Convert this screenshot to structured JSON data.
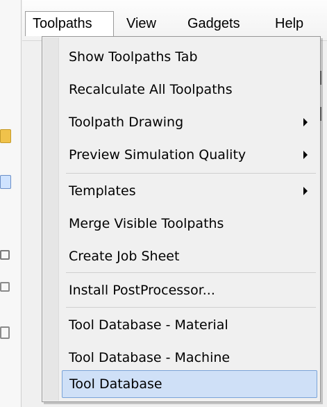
{
  "menubar": {
    "items": [
      {
        "label": "Toolpaths"
      },
      {
        "label": "View"
      },
      {
        "label": "Gadgets"
      },
      {
        "label": "Help"
      }
    ]
  },
  "dropdown": {
    "items": [
      {
        "label": "Show Toolpaths Tab"
      },
      {
        "label": "Recalculate All Toolpaths"
      },
      {
        "label": "Toolpath Drawing"
      },
      {
        "label": "Preview Simulation Quality"
      },
      {
        "label": "Templates"
      },
      {
        "label": "Merge Visible Toolpaths"
      },
      {
        "label": "Create Job Sheet"
      },
      {
        "label": "Install PostProcessor..."
      },
      {
        "label": "Tool Database - Material"
      },
      {
        "label": "Tool Database - Machine"
      },
      {
        "label": "Tool Database"
      }
    ]
  },
  "icons": {
    "submenu_indicator": "chevron-right-icon"
  }
}
